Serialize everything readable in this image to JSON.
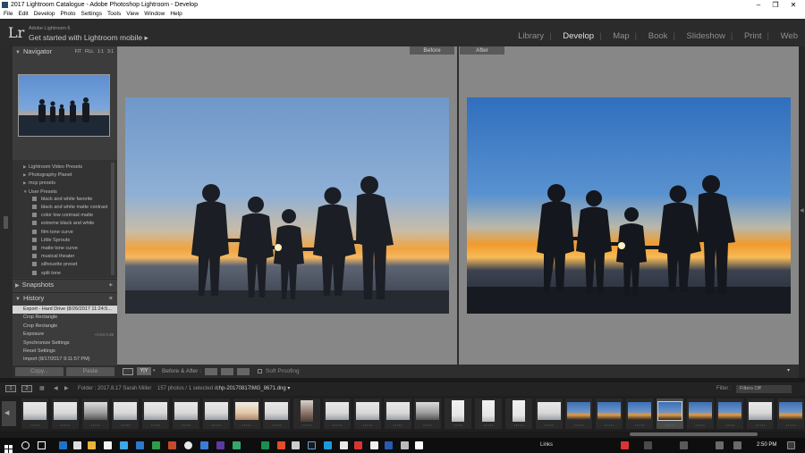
{
  "window": {
    "title": "2017 Lightroom Catalogue - Adobe Photoshop Lightroom - Develop",
    "controls": [
      "–",
      "❐",
      "✕"
    ]
  },
  "menu": [
    "File",
    "Edit",
    "Develop",
    "Photo",
    "Settings",
    "Tools",
    "View",
    "Window",
    "Help"
  ],
  "identity": {
    "logo": "Lr",
    "product": "Adobe Lightroom 6",
    "mobile": "Get started with Lightroom mobile ▸"
  },
  "modules": {
    "items": [
      "Library",
      "Develop",
      "Map",
      "Book",
      "Slideshow",
      "Print",
      "Web"
    ],
    "active": "Develop"
  },
  "navigator": {
    "title": "Navigator",
    "zoom": [
      "FIT",
      "FILL",
      "1:1",
      "3:1"
    ]
  },
  "presets": [
    {
      "type": "folder",
      "label": "Lightroom Video Presets",
      "open": false
    },
    {
      "type": "folder",
      "label": "Photography Planet",
      "open": false
    },
    {
      "type": "folder",
      "label": "mcp presets",
      "open": false
    },
    {
      "type": "folder",
      "label": "User Presets",
      "open": true
    },
    {
      "type": "item",
      "label": "black and white favorite"
    },
    {
      "type": "item",
      "label": "black and white matte contrast"
    },
    {
      "type": "item",
      "label": "color low contrast matte"
    },
    {
      "type": "item",
      "label": "extreme black and white"
    },
    {
      "type": "item",
      "label": "film tone curve"
    },
    {
      "type": "item",
      "label": "Little Sprouts"
    },
    {
      "type": "item",
      "label": "matte tone curve"
    },
    {
      "type": "item",
      "label": "musical theater"
    },
    {
      "type": "item",
      "label": "silhouette preset"
    },
    {
      "type": "item",
      "label": "split tone"
    }
  ],
  "snapshots": {
    "title": "Snapshots",
    "action": "+"
  },
  "history": {
    "title": "History",
    "action": "×",
    "items": [
      {
        "label": "Export - Hard Drive (8/26/2017 11:24:5...",
        "selected": true,
        "values": ""
      },
      {
        "label": "Crop Rectangle",
        "values": ""
      },
      {
        "label": "Crop Rectangle",
        "values": ""
      },
      {
        "label": "Exposure",
        "values": "+0.04   0.39"
      },
      {
        "label": "Synchronize Settings",
        "values": ""
      },
      {
        "label": "Reset Settings",
        "values": ""
      },
      {
        "label": "Import (8/17/2017 9:11:57 PM)",
        "values": ""
      }
    ]
  },
  "copy_paste": {
    "copy": "Copy...",
    "paste": "Paste"
  },
  "before_after": {
    "before": "Before",
    "after": "After"
  },
  "toolbar": {
    "ba_icon": "Y|Y",
    "before_after_label": "Before & After :",
    "soft_proofing": "Soft Proofing"
  },
  "filmstrip_header": {
    "screen1": "1",
    "screen2": "2",
    "folder": "Folder : 2017.8.17 Sarah Miller",
    "count": "157 photos / 1 selected",
    "filename": "/chp-20170817IMG_8671.dng ▾",
    "filter_label": "Filter :",
    "filter_value": "Filters Off"
  },
  "filmstrip_thumbs": [
    {
      "kind": "group-w"
    },
    {
      "kind": "group-w"
    },
    {
      "kind": "bw"
    },
    {
      "kind": "group-w"
    },
    {
      "kind": "group-w"
    },
    {
      "kind": "group-w"
    },
    {
      "kind": "group-w"
    },
    {
      "kind": "group-warm"
    },
    {
      "kind": "group-w"
    },
    {
      "kind": "portrait"
    },
    {
      "kind": "group-w"
    },
    {
      "kind": "group-w"
    },
    {
      "kind": "group-w"
    },
    {
      "kind": "bw"
    },
    {
      "kind": "portrait-w"
    },
    {
      "kind": "portrait-w"
    },
    {
      "kind": "portrait-w"
    },
    {
      "kind": "group-w"
    },
    {
      "kind": "sunset"
    },
    {
      "kind": "sunset"
    },
    {
      "kind": "sunset"
    },
    {
      "kind": "sunset-sel"
    },
    {
      "kind": "sunset"
    },
    {
      "kind": "sunset"
    },
    {
      "kind": "group-w"
    },
    {
      "kind": "sunset"
    }
  ],
  "taskbar": {
    "links": "Links",
    "time": "2:50 PM"
  },
  "colors": {
    "sky_top": "#4d7fc1",
    "sunset": "#f0a33c",
    "panel": "#3c3c3c",
    "canvas": "#878787"
  }
}
